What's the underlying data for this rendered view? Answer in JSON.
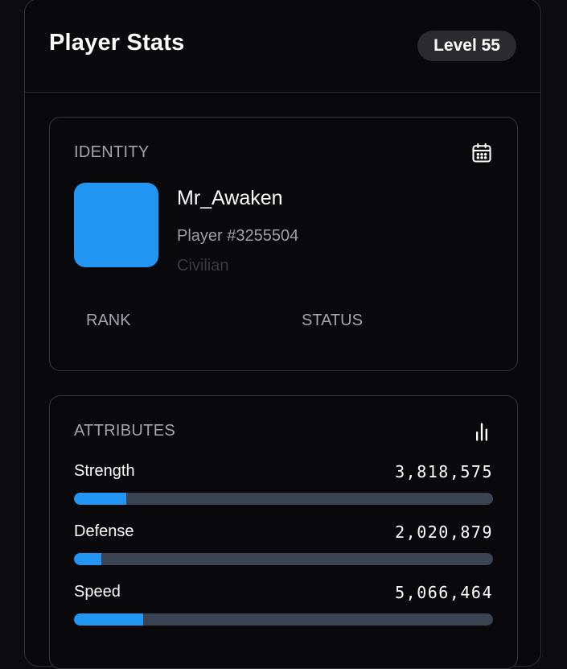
{
  "header": {
    "title": "Player Stats",
    "level_badge": "Level 55"
  },
  "identity": {
    "label": "IDENTITY",
    "icon": "calendar-icon",
    "avatar_color": "#2196f3",
    "name": "Mr_Awaken",
    "player_id": "Player #3255504",
    "role": "Civilian",
    "rank_label": "RANK",
    "status_label": "STATUS"
  },
  "attributes": {
    "label": "ATTRIBUTES",
    "icon": "bar-chart-icon",
    "bar_color": "#2196f3",
    "track_color": "#394351",
    "stats": [
      {
        "name": "Strength",
        "value": "3,818,575",
        "fill_percent": 12.5
      },
      {
        "name": "Defense",
        "value": "2,020,879",
        "fill_percent": 6.5
      },
      {
        "name": "Speed",
        "value": "5,066,464",
        "fill_percent": 16.5
      }
    ]
  }
}
